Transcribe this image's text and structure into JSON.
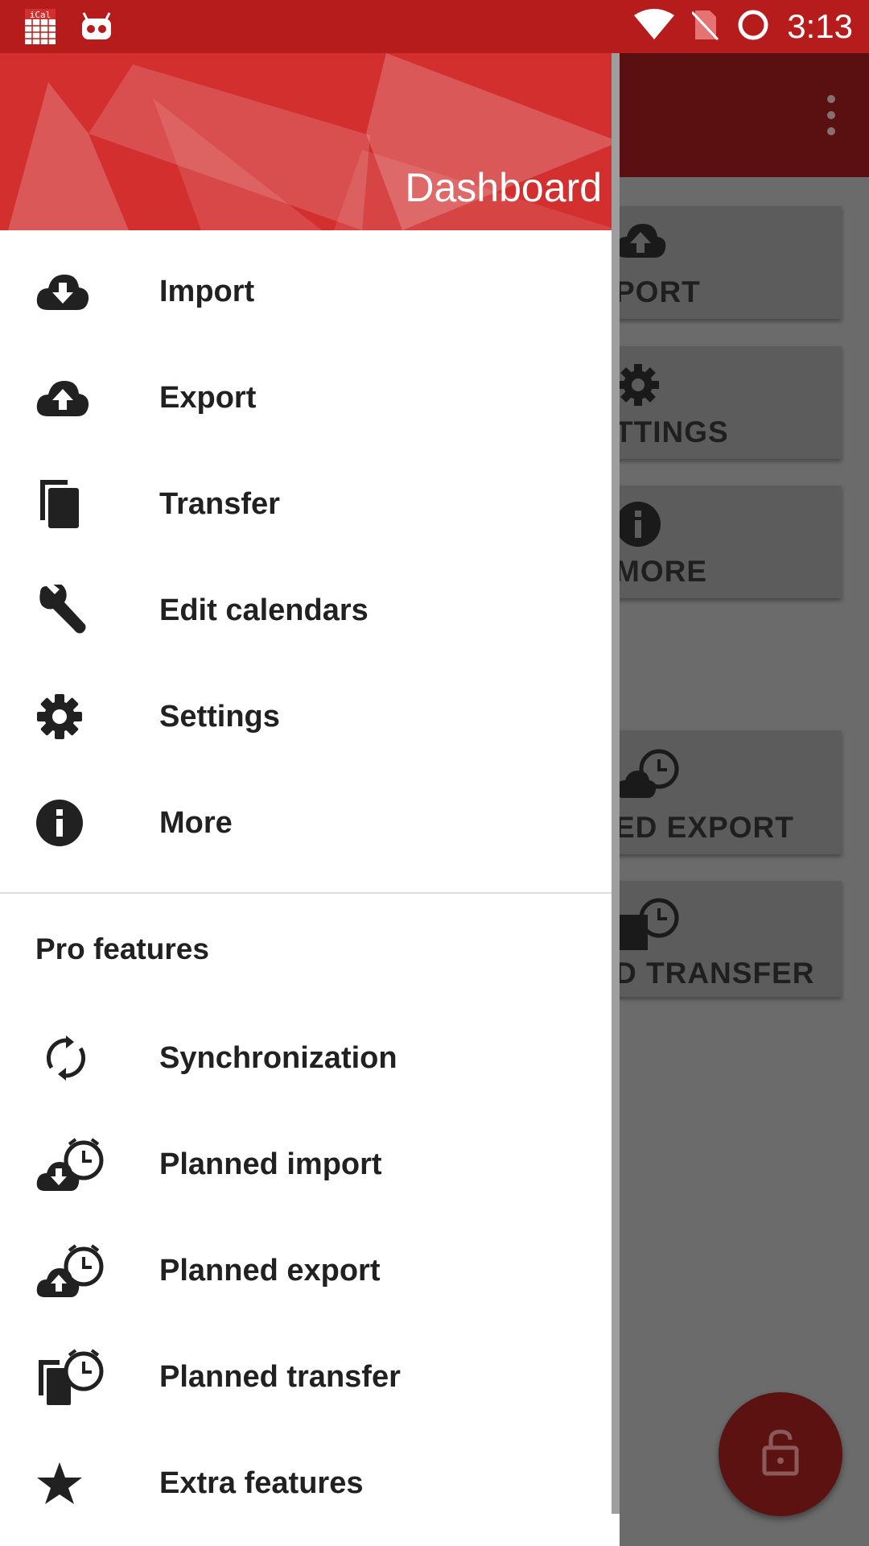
{
  "status_bar": {
    "time": "3:13",
    "left_icons": [
      "ical-app-icon",
      "android-robot-icon"
    ],
    "right_icons": [
      "wifi-icon",
      "no-sim-icon",
      "battery-ring-icon"
    ]
  },
  "drawer": {
    "header_title": "Dashboard",
    "primary_items": [
      {
        "label": "Import",
        "icon": "cloud-download-icon"
      },
      {
        "label": "Export",
        "icon": "cloud-upload-icon"
      },
      {
        "label": "Transfer",
        "icon": "copy-icon"
      },
      {
        "label": "Edit calendars",
        "icon": "wrench-icon"
      },
      {
        "label": "Settings",
        "icon": "gear-icon"
      },
      {
        "label": "More",
        "icon": "info-icon"
      }
    ],
    "section_title": "Pro features",
    "pro_items": [
      {
        "label": "Synchronization",
        "icon": "sync-icon"
      },
      {
        "label": "Planned import",
        "icon": "cloud-download-alarm-icon"
      },
      {
        "label": "Planned export",
        "icon": "cloud-upload-alarm-icon"
      },
      {
        "label": "Planned transfer",
        "icon": "copy-alarm-icon"
      },
      {
        "label": "Extra features",
        "icon": "star-icon"
      }
    ]
  },
  "background": {
    "cards": [
      {
        "label": "PORT",
        "icon": "cloud-upload-icon"
      },
      {
        "label": "TTINGS",
        "icon": "gear-icon"
      },
      {
        "label": "MORE",
        "icon": "info-icon"
      },
      {
        "label": "ED EXPORT",
        "icon": "cloud-upload-alarm-icon"
      },
      {
        "label": "D TRANSFER",
        "icon": "copy-alarm-icon"
      }
    ],
    "fab_icon": "lock-open-icon"
  },
  "colors": {
    "status_bar": "#b71c1c",
    "header": "#d32f2f",
    "scrim_app_bar": "#5a1010",
    "fab": "#5d1212"
  }
}
